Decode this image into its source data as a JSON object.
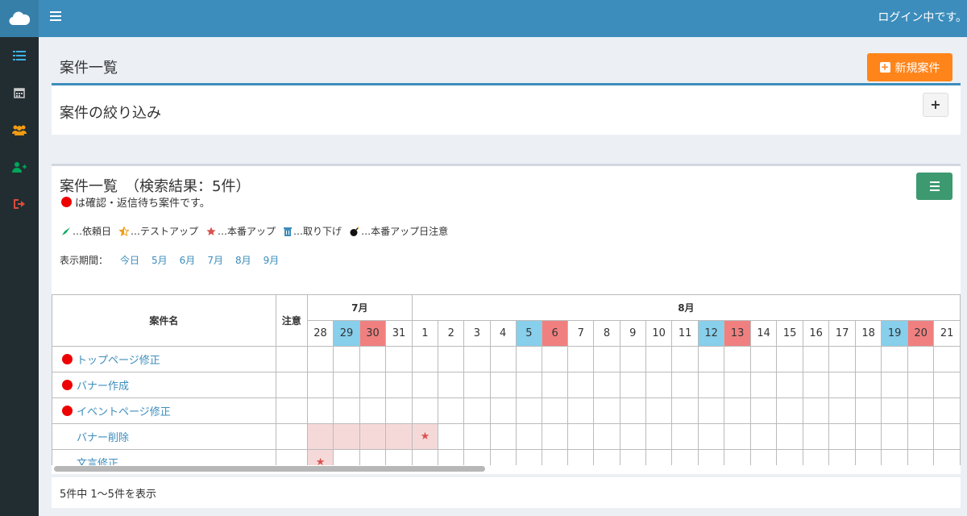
{
  "header": {
    "login_text": "ログイン中です。"
  },
  "sidebar": {
    "icons": [
      {
        "name": "cloud-logo-icon",
        "color": "#ffffff"
      },
      {
        "name": "list-icon",
        "color": "#3cb4e5"
      },
      {
        "name": "calendar-icon",
        "color": "#cccccc"
      },
      {
        "name": "users-icon",
        "color": "#f39c12"
      },
      {
        "name": "add-user-icon",
        "color": "#00a65a"
      },
      {
        "name": "sign-out-icon",
        "color": "#dd4b39"
      }
    ]
  },
  "page": {
    "title": "案件一覧",
    "new_button": "新規案件",
    "new_button_color": "#ff851b"
  },
  "filter": {
    "title": "案件の絞り込み",
    "toggle_label": "+"
  },
  "list": {
    "title": "案件一覧　（検索結果：5件）",
    "note": "は確認・返信待ち案件です。",
    "legend": [
      {
        "icon": "rocket-icon",
        "label": "…依頼日"
      },
      {
        "icon": "star-half-icon",
        "label": "…テストアップ"
      },
      {
        "icon": "star-icon",
        "label": "…本番アップ"
      },
      {
        "icon": "trash-icon",
        "label": "…取り下げ"
      },
      {
        "icon": "bomb-icon",
        "label": "…本番アップ日注意"
      }
    ],
    "period_label": "表示期間：",
    "period_links": [
      "今日",
      "5月",
      "6月",
      "7月",
      "8月",
      "9月"
    ]
  },
  "table": {
    "col_project": "案件名",
    "col_note": "注意",
    "months": [
      {
        "label": "7月",
        "span": 4
      },
      {
        "label": "8月",
        "span": 21
      }
    ],
    "days": [
      "28",
      "29",
      "30",
      "31",
      "1",
      "2",
      "3",
      "4",
      "5",
      "6",
      "7",
      "8",
      "9",
      "10",
      "11",
      "12",
      "13",
      "14",
      "15",
      "16",
      "17",
      "18",
      "19",
      "20",
      "21"
    ],
    "day_colors": {
      "1": "blue",
      "2": "red",
      "8": "blue",
      "9": "red",
      "15": "blue",
      "16": "red",
      "22": "blue",
      "23": "red"
    },
    "rows": [
      {
        "name": "トップページ修正",
        "pending": true,
        "shade": [],
        "stars": []
      },
      {
        "name": "バナー作成",
        "pending": true,
        "shade": [],
        "stars": []
      },
      {
        "name": "イベントページ修正",
        "pending": true,
        "shade": [],
        "stars": []
      },
      {
        "name": "バナー削除",
        "pending": false,
        "shade": [
          0,
          1,
          2,
          3,
          4
        ],
        "stars": [
          4
        ]
      },
      {
        "name": "文言修正",
        "pending": false,
        "shade": [
          0
        ],
        "stars": [
          0
        ]
      }
    ]
  },
  "footer": {
    "summary": "5件中 1〜5件を表示"
  }
}
